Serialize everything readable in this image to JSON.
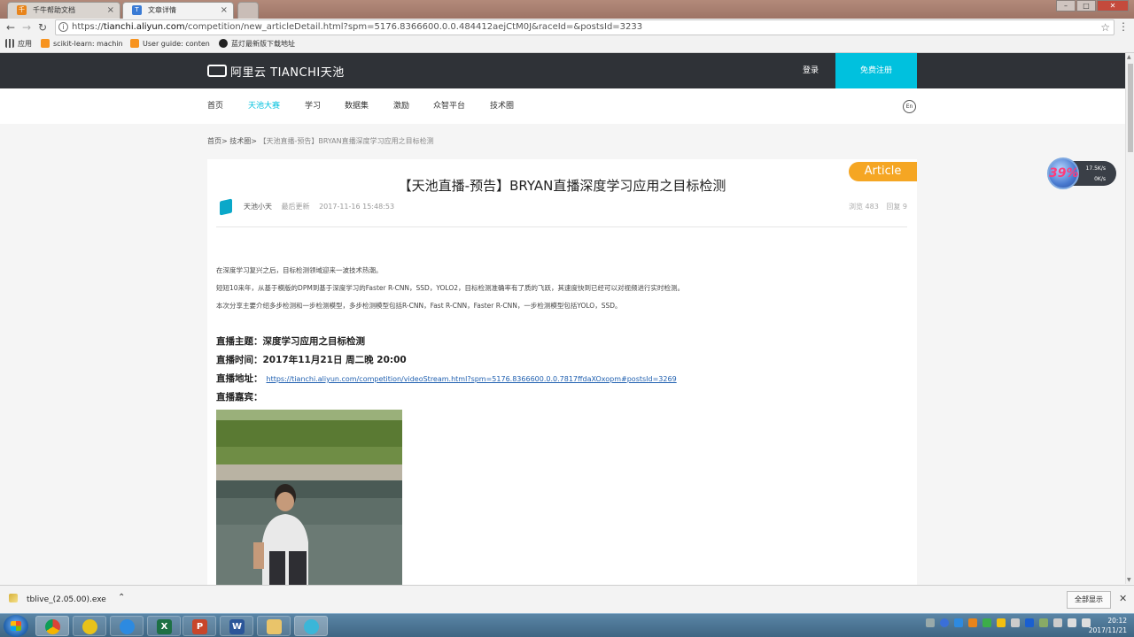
{
  "browser": {
    "tabs": [
      {
        "title": "千牛帮助文档",
        "favicon": "千",
        "favicon_color": "#e8841b"
      },
      {
        "title": "文章详情",
        "favicon": "T",
        "favicon_color": "#3a7bd5"
      }
    ],
    "url_prefix": "https://",
    "url_host": "tianchi.aliyun.com",
    "url_path": "/competition/new_articleDetail.html?spm=5176.8366600.0.0.484412aejCtM0J&raceId=&postsId=3233",
    "bookmarks": [
      {
        "label": "应用",
        "icon": "apps-icon"
      },
      {
        "label": "scikit-learn: machin",
        "icon": "sklearn-icon"
      },
      {
        "label": "User guide: conten",
        "icon": "sklearn-icon"
      },
      {
        "label": "蓝灯最新版下载地址",
        "icon": "github-icon"
      }
    ]
  },
  "site": {
    "logo_text": "阿里云 TIANCHI天池",
    "login": "登录",
    "register": "免费注册",
    "nav": [
      "首页",
      "天池大赛",
      "学习",
      "数据集",
      "激励",
      "众智平台",
      "技术圈"
    ],
    "nav_active_index": 1,
    "lang": "En",
    "brand_color": "#00c1de"
  },
  "breadcrumb": {
    "home": "首页>",
    "section": "技术圈>",
    "current": "【天池直播-预告】BRYAN直播深度学习应用之目标检测"
  },
  "article": {
    "badge": "Article",
    "title": "【天池直播-预告】BRYAN直播深度学习应用之目标检测",
    "author": "天池小天",
    "updated_label": "最后更新",
    "updated_time": "2017-11-16 15:48:53",
    "views": "浏览 483",
    "replies": "回复 9",
    "paragraphs": [
      "在深度学习复兴之后，目标检测领域迎来一波技术热潮。",
      "短短10来年，从基于模版的DPM到基于深度学习的Faster R-CNN，SSD，YOLO2，目标检测准确率有了质的飞跃，其速度快到已经可以对视频进行实时检测。",
      "本次分享主要介绍多步检测和一步检测模型，多步检测模型包括R-CNN，Fast R-CNN，Faster R-CNN，一步检测模型包括YOLO，SSD。"
    ],
    "live_topic": "直播主题：深度学习应用之目标检测",
    "live_time": "直播时间：2017年11月21日 周二晚 20:00",
    "live_addr_label": "直播地址：",
    "live_addr_url": "https://tianchi.aliyun.com/competition/videoStream.html?spm=5176.8366600.0.0.7817ffdaXOxopm#postsId=3269",
    "live_guest": "直播嘉宾："
  },
  "speed_widget": {
    "percent": "39%",
    "up": "17.5K/s",
    "down": "0K/s"
  },
  "download": {
    "filename": "tblive_(2.05.00).exe",
    "show_all": "全部显示"
  },
  "taskbar": {
    "time": "20:12",
    "date": "2017/11/21"
  }
}
